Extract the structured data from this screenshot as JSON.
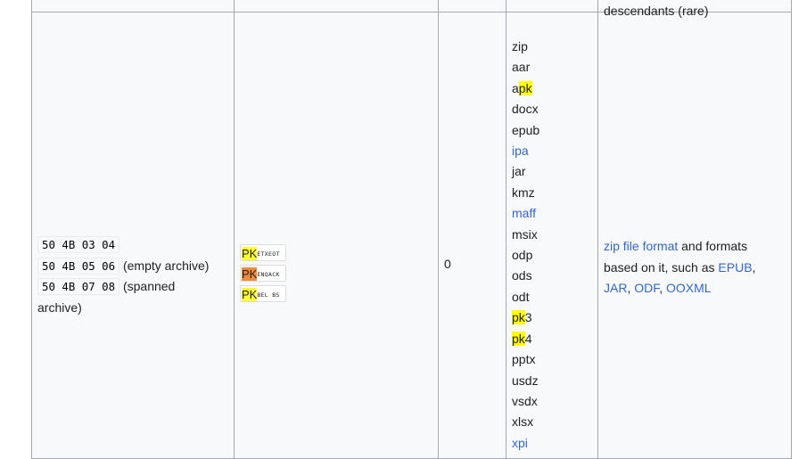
{
  "top_row": {
    "description_fragment": "descendants (rare)"
  },
  "row": {
    "hex_signatures": [
      {
        "hex": "50 4B 03 04",
        "note": ""
      },
      {
        "hex": "50 4B 05 06",
        "note": "(empty archive)"
      },
      {
        "hex": "50 4B 07 08",
        "note": "(spanned"
      }
    ],
    "hex_note_continued": "archive)",
    "iso_chips": [
      {
        "pk": "PK",
        "ctrl": "ETXEOT",
        "pk_color": "#ffff33"
      },
      {
        "pk": "PK",
        "ctrl": "ENQACK",
        "pk_color": "#f08a3c"
      },
      {
        "pk": "PK",
        "ctrl": "BEL BS",
        "pk_color": "#ffff33"
      }
    ],
    "offset": "0",
    "extensions": [
      {
        "pre": "zip",
        "hl": "",
        "post": "",
        "link": false
      },
      {
        "pre": "aar",
        "hl": "",
        "post": "",
        "link": false
      },
      {
        "pre": "a",
        "hl": "pk",
        "post": "",
        "link": false
      },
      {
        "pre": "docx",
        "hl": "",
        "post": "",
        "link": false
      },
      {
        "pre": "epub",
        "hl": "",
        "post": "",
        "link": false
      },
      {
        "pre": "ipa",
        "hl": "",
        "post": "",
        "link": true
      },
      {
        "pre": "jar",
        "hl": "",
        "post": "",
        "link": false
      },
      {
        "pre": "kmz",
        "hl": "",
        "post": "",
        "link": false
      },
      {
        "pre": "maff",
        "hl": "",
        "post": "",
        "link": true
      },
      {
        "pre": "msix",
        "hl": "",
        "post": "",
        "link": false
      },
      {
        "pre": "odp",
        "hl": "",
        "post": "",
        "link": false
      },
      {
        "pre": "ods",
        "hl": "",
        "post": "",
        "link": false
      },
      {
        "pre": "odt",
        "hl": "",
        "post": "",
        "link": false
      },
      {
        "pre": "",
        "hl": "pk",
        "post": "3",
        "link": false
      },
      {
        "pre": "",
        "hl": "pk",
        "post": "4",
        "link": false
      },
      {
        "pre": "pptx",
        "hl": "",
        "post": "",
        "link": false
      },
      {
        "pre": "usdz",
        "hl": "",
        "post": "",
        "link": false
      },
      {
        "pre": "vsdx",
        "hl": "",
        "post": "",
        "link": false
      },
      {
        "pre": "xlsx",
        "hl": "",
        "post": "",
        "link": false
      },
      {
        "pre": "xpi",
        "hl": "",
        "post": "",
        "link": true
      }
    ],
    "description": {
      "link_zip": "zip file format",
      "text1": " and formats based on it, such as ",
      "link_epub": "EPUB",
      "sep1": ", ",
      "link_jar": "JAR",
      "sep2": ", ",
      "link_odf": "ODF",
      "sep3": ", ",
      "link_ooxml": "OOXML"
    }
  },
  "colors": {
    "link": "#3366cc",
    "highlight_yellow": "#ffff00",
    "chip_yellow": "#ffff33",
    "chip_orange": "#f08a3c",
    "border": "#a2a9b1",
    "cell_bg": "#f8f9fa"
  }
}
